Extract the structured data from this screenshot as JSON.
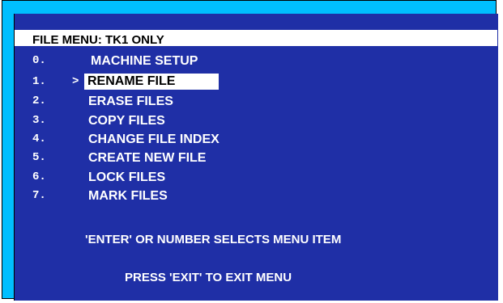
{
  "menu": {
    "title": "FILE MENU: TK1 ONLY",
    "cursor_symbol": ">",
    "items": [
      {
        "number": "0.",
        "label": "MACHINE SETUP",
        "selected": false
      },
      {
        "number": "1.",
        "label": "RENAME FILE",
        "selected": true
      },
      {
        "number": "2.",
        "label": "ERASE FILES",
        "selected": false
      },
      {
        "number": "3.",
        "label": "COPY FILES",
        "selected": false
      },
      {
        "number": "4.",
        "label": "CHANGE FILE INDEX",
        "selected": false
      },
      {
        "number": "5.",
        "label": "CREATE NEW FILE",
        "selected": false
      },
      {
        "number": "6.",
        "label": "LOCK FILES",
        "selected": false
      },
      {
        "number": "7.",
        "label": "MARK FILES",
        "selected": false
      }
    ]
  },
  "instructions": {
    "select_hint": "'ENTER' OR NUMBER SELECTS MENU ITEM",
    "exit_hint": "PRESS 'EXIT' TO EXIT MENU"
  },
  "colors": {
    "outer_frame": "#00bfff",
    "screen_background": "#1f2fa6",
    "text": "#ffffff",
    "highlight_background": "#ffffff",
    "highlight_text": "#000000"
  }
}
